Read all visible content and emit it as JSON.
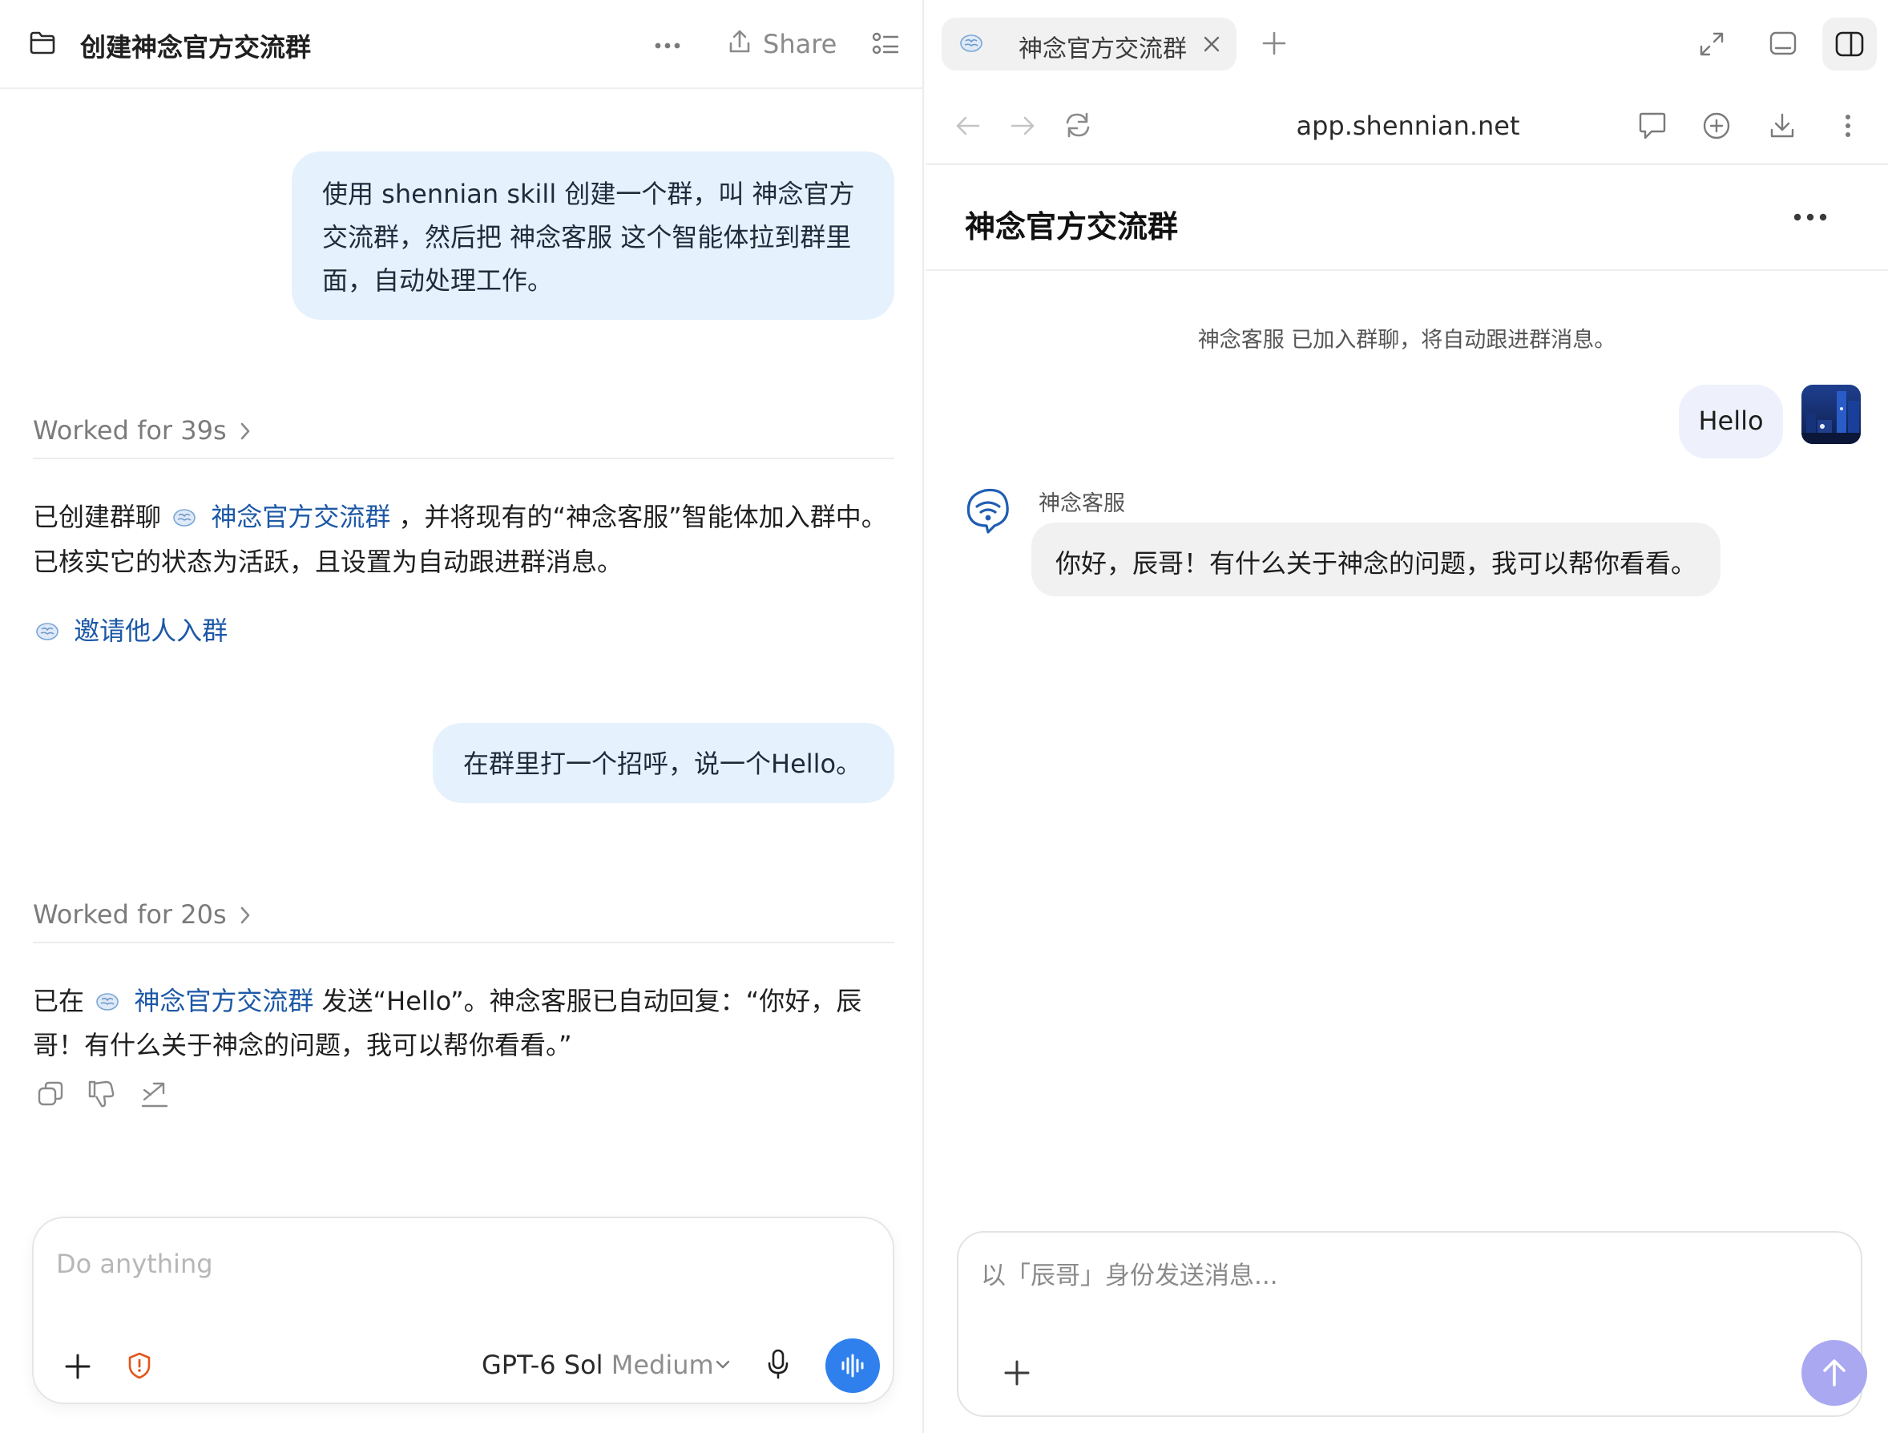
{
  "left": {
    "header": {
      "title": "创建神念官方交流群",
      "share_label": "Share"
    },
    "messages": {
      "user1_lines": [
        "使用 shennian skill 创建一个群，叫 神念官方",
        "交流群，然后把 神念客服 这个智能体拉到群里",
        "面，自动处理工作。"
      ],
      "worked1": "Worked for 39s",
      "reply1": {
        "line1_prefix": "已创建群聊",
        "line1_link": "神念官方交流群",
        "line1_suffix": "，并将现有的“神念客服”智能体加入群中。",
        "line2": "已核实它的状态为活跃，且设置为自动跟进群消息。",
        "invite_link": "邀请他人入群"
      },
      "user2": "在群里打一个招呼，说一个Hello。",
      "worked2": "Worked for 20s",
      "reply2": {
        "line1_prefix": "已在",
        "line1_link": "神念官方交流群",
        "line1_suffix": "发送“Hello”。神念客服已自动回复：“你好，辰",
        "line2": "哥！有什么关于神念的问题，我可以帮你看看。”"
      }
    },
    "composer": {
      "placeholder": "Do anything",
      "model_name": "GPT-6 Sol",
      "model_effort": "Medium"
    }
  },
  "right": {
    "tab_title": "神念官方交流群",
    "url": "app.shennian.net",
    "group_title": "神念官方交流群",
    "system_message": "神念客服 已加入群聊，将自动跟进群消息。",
    "user_message": "Hello",
    "bot_name": "神念客服",
    "bot_message": "你好，辰哥！有什么关于神念的问题，我可以帮你看看。",
    "composer_placeholder": "以「辰哥」身份发送消息..."
  },
  "colors": {
    "user_bubble": "#e5f1fd",
    "link": "#1c58a6",
    "voice_button": "#2f80ed",
    "send_button": "#a9a8f1",
    "shield_icon": "#e3561a"
  },
  "icons": [
    "folder-icon",
    "more-horizontal-icon",
    "share-icon",
    "list-icon",
    "brain-icon",
    "chevron-right-icon",
    "copy-icon",
    "thumbs-down-icon",
    "branch-icon",
    "plus-icon",
    "shield-alert-icon",
    "chevron-down-icon",
    "mic-icon",
    "voice-wave-icon",
    "close-icon",
    "expand-icon",
    "minimize-panel-icon",
    "sidebar-toggle-icon",
    "back-arrow-icon",
    "forward-arrow-icon",
    "reload-icon",
    "comment-icon",
    "add-circle-icon",
    "download-icon",
    "more-vertical-icon",
    "bot-wifi-icon",
    "send-arrow-icon"
  ]
}
